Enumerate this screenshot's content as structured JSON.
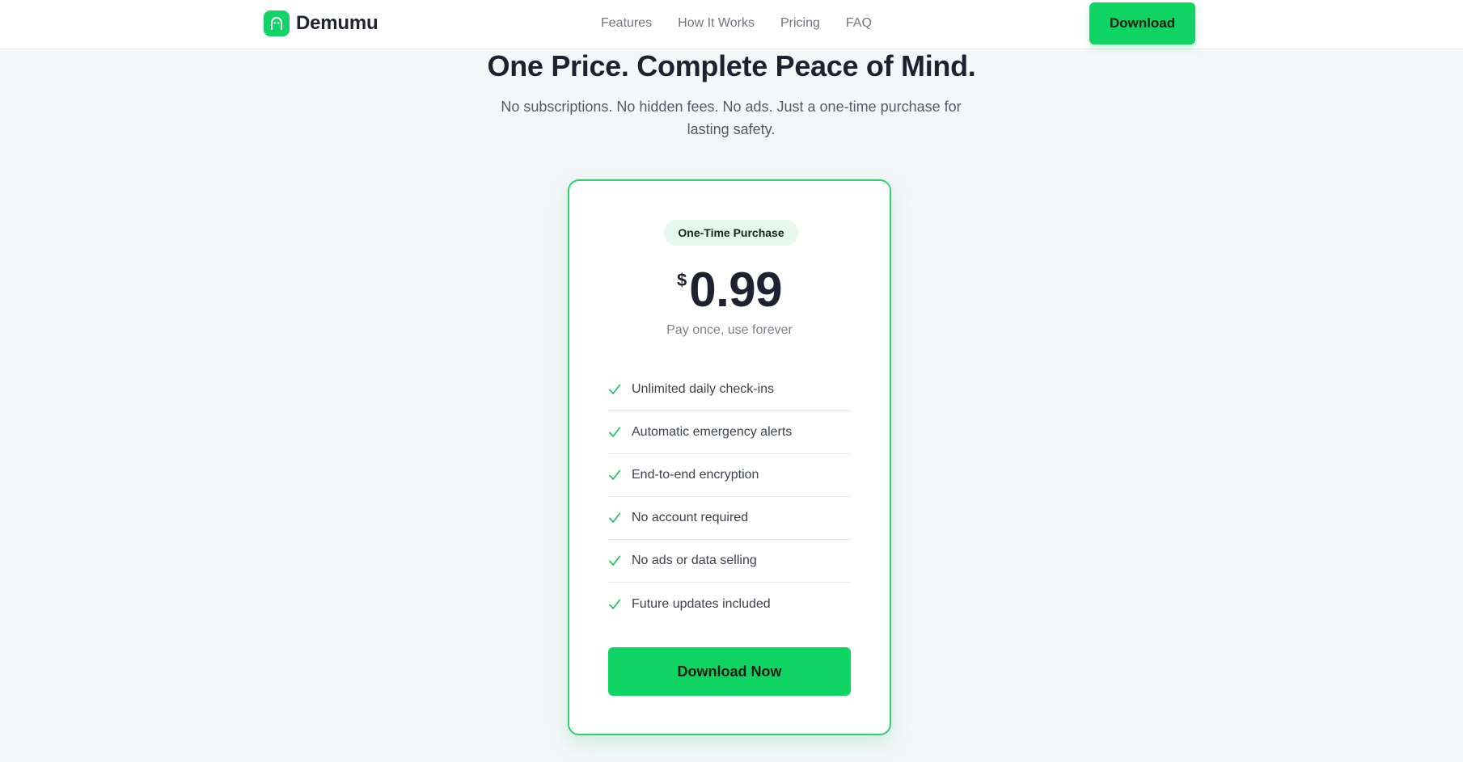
{
  "header": {
    "brand_name": "Demumu",
    "nav": [
      "Features",
      "How It Works",
      "Pricing",
      "FAQ"
    ],
    "download_label": "Download"
  },
  "hero": {
    "title": "One Price. Complete Peace of Mind.",
    "subtitle": "No subscriptions. No hidden fees. No ads. Just a one-time purchase for lasting safety."
  },
  "pricing": {
    "badge": "One-Time Purchase",
    "currency": "$",
    "amount": "0.99",
    "note": "Pay once, use forever",
    "features": [
      "Unlimited daily check-ins",
      "Automatic emergency alerts",
      "End-to-end encryption",
      "No account required",
      "No ads or data selling",
      "Future updates included"
    ],
    "cta_label": "Download Now"
  },
  "icons": {
    "logo": "ghost-icon",
    "feature_check": "check-icon"
  },
  "colors": {
    "brand_green": "#0fd463",
    "card_border": "#2fd06d",
    "badge_background": "#e6f8ed",
    "page_background": "#f4f6f9"
  }
}
